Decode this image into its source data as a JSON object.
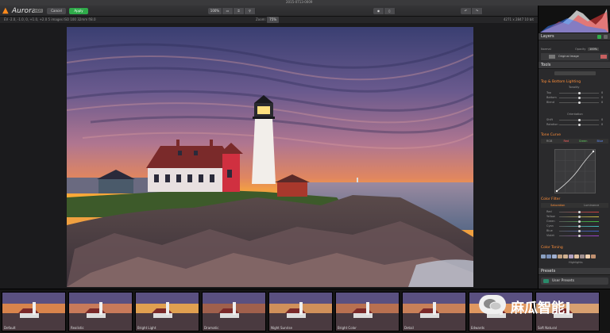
{
  "window": {
    "title": "2015-0713-0009"
  },
  "toolbar": {
    "app_name": "Aurora",
    "app_badge": "HDR",
    "cancel_label": "Cancel",
    "apply_label": "Apply",
    "view_zoom_label": "100%",
    "view_icons": [
      "compare-icon",
      "crop-icon",
      "search-icon"
    ],
    "center_icons": [
      "eye-icon",
      "split-icon"
    ],
    "undo_icons": [
      "undo-icon",
      "redo-icon"
    ],
    "right_icons": [
      "brush-icon",
      "layers-icon",
      "export-icon"
    ]
  },
  "infobar": {
    "left": "EV -2.0, -1.0, 0, +1.0, +2.0    5 images    ISO 100    32mm    f/8.0",
    "zoom_label": "Zoom:",
    "zoom_value": "75%",
    "right": "4271 x 2847   10 bit"
  },
  "panel": {
    "layers_header": "Layers",
    "layer_label": "Original Image",
    "normal_label": "Normal",
    "opacity_label": "Opacity",
    "opacity_value": "100%",
    "tools_header": "Tools",
    "section_top_bottom": "Top & Bottom Lighting",
    "tonality_label": "Tonality",
    "tonality_sliders": [
      {
        "name": "Top",
        "value": "0"
      },
      {
        "name": "Bottom",
        "value": "0"
      },
      {
        "name": "Blend",
        "value": "0"
      }
    ],
    "orientation_label": "Orientation",
    "orientation_sliders": [
      {
        "name": "Shift",
        "value": "0"
      },
      {
        "name": "Rotation",
        "value": "0"
      }
    ],
    "section_tone_curve": "Tone Curve",
    "tone_tabs": [
      "RGB",
      "Red",
      "Green",
      "Blue"
    ],
    "section_color_filter": "Color Filter",
    "color_filter_tabs": [
      "Saturation",
      "Luminance"
    ],
    "color_sliders": [
      {
        "name": "Red",
        "value": "0"
      },
      {
        "name": "Yellow",
        "value": "0"
      },
      {
        "name": "Green",
        "value": "0"
      },
      {
        "name": "Cyan",
        "value": "0"
      },
      {
        "name": "Blue",
        "value": "0"
      },
      {
        "name": "Violet",
        "value": "0"
      }
    ],
    "section_color_toning": "Color Toning",
    "highlights_label": "Highlights",
    "presets_header": "Presets",
    "presets_dropdown": "User Presets"
  },
  "filmstrip": {
    "thumbs": [
      "Default",
      "Realistic",
      "Bright Light",
      "Dramatic",
      "Night Sunrise",
      "Bright Color",
      "Detail",
      "Edwards",
      "Soft Natural"
    ]
  },
  "watermark": {
    "text": "麻瓜智能"
  },
  "colors": {
    "accent": "#ff8f3a",
    "apply": "#2faa4a",
    "panel": "#2a2a2c"
  }
}
